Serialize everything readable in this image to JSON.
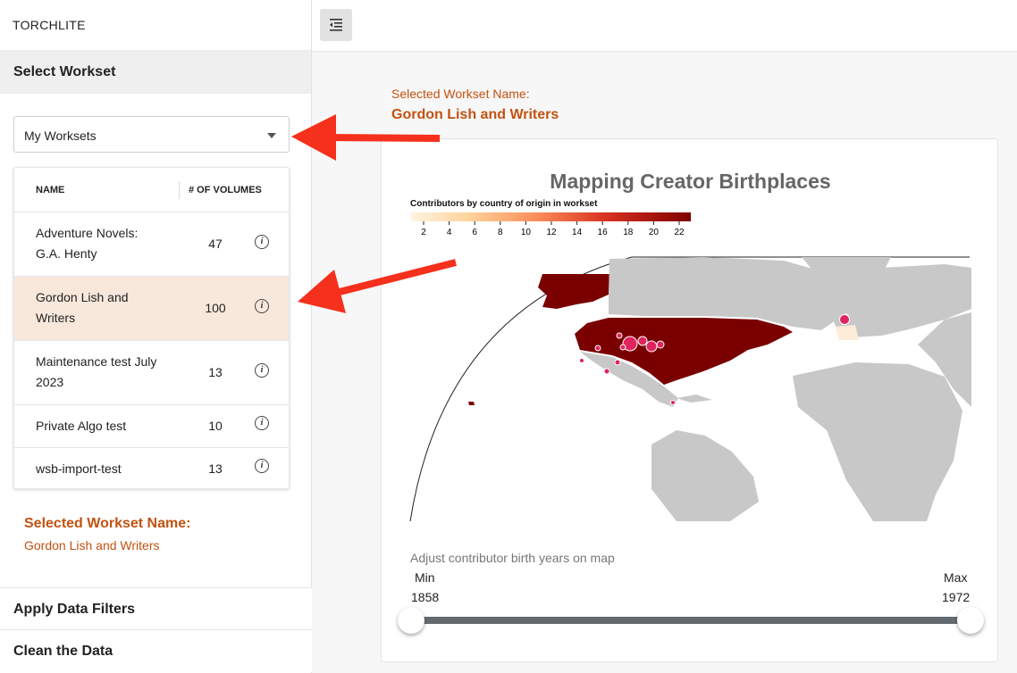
{
  "app": {
    "brand": "TORCHLITE"
  },
  "sidebar": {
    "section_title": "Select Workset",
    "workset_select": {
      "value": "My Worksets"
    },
    "table": {
      "col_name": "NAME",
      "col_volumes": "# OF VOLUMES",
      "rows": [
        {
          "name_line1": "Adventure Novels:",
          "name_line2": "G.A. Henty",
          "volumes": "47",
          "selected": false
        },
        {
          "name_line1": "Gordon Lish and",
          "name_line2": "Writers",
          "volumes": "100",
          "selected": true
        },
        {
          "name_line1": "Maintenance test July",
          "name_line2": "2023",
          "volumes": "13",
          "selected": false
        },
        {
          "name_line1": "Private Algo test",
          "name_line2": "",
          "volumes": "10",
          "selected": false
        },
        {
          "name_line1": "wsb-import-test",
          "name_line2": "",
          "volumes": "13",
          "selected": false
        }
      ],
      "info_glyph": "i"
    },
    "selected_label": "Selected Workset Name:",
    "selected_value": "Gordon Lish and Writers",
    "accordion": [
      "Apply Data Filters",
      "Clean the Data"
    ]
  },
  "main": {
    "selected_label": "Selected Workset Name:",
    "selected_value": "Gordon Lish and Writers",
    "map": {
      "title": "Mapping Creator Birthplaces",
      "legend_title": "Contributors by country of origin in workset",
      "legend_ticks": [
        "2",
        "4",
        "6",
        "8",
        "10",
        "12",
        "14",
        "16",
        "18",
        "20",
        "22"
      ],
      "colors": {
        "land": "#c8c8c8",
        "usa": "#7a0000",
        "marker": "#e0245e"
      }
    },
    "slider": {
      "label": "Adjust contributor birth years on map",
      "min_label": "Min",
      "max_label": "Max",
      "min_value": "1858",
      "max_value": "1972"
    }
  },
  "annotations": {
    "arrow_color": "#f5301c"
  }
}
